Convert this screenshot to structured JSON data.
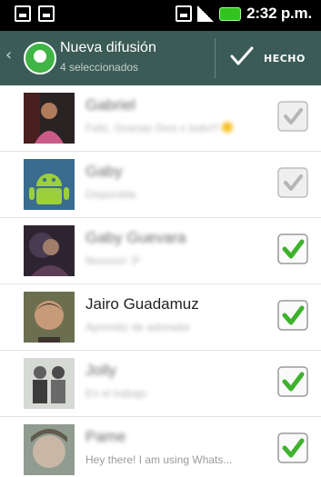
{
  "status_bar": {
    "time": "2:32 p.m."
  },
  "action_bar": {
    "title": "Nueva difusión",
    "subtitle": "4 seleccionados",
    "done_label": "HECHO"
  },
  "contacts": [
    {
      "name": "Gabriel",
      "status": "Feliz, Gracias Dios x todo!!!",
      "checked": true,
      "disabled": true
    },
    {
      "name": "Gaby",
      "status": "Disponible",
      "checked": true,
      "disabled": true
    },
    {
      "name": "Gaby Guevara",
      "status": "Nooooo! :P",
      "checked": true,
      "disabled": false
    },
    {
      "name": "Jairo Guadamuz",
      "status": "Aprendiz de adorador",
      "checked": true,
      "disabled": false
    },
    {
      "name": "Jolly",
      "status": "En el trabajo",
      "checked": true,
      "disabled": false
    },
    {
      "name": "Pame",
      "status": "Hey there! I am using Whats...",
      "checked": true,
      "disabled": false
    }
  ]
}
